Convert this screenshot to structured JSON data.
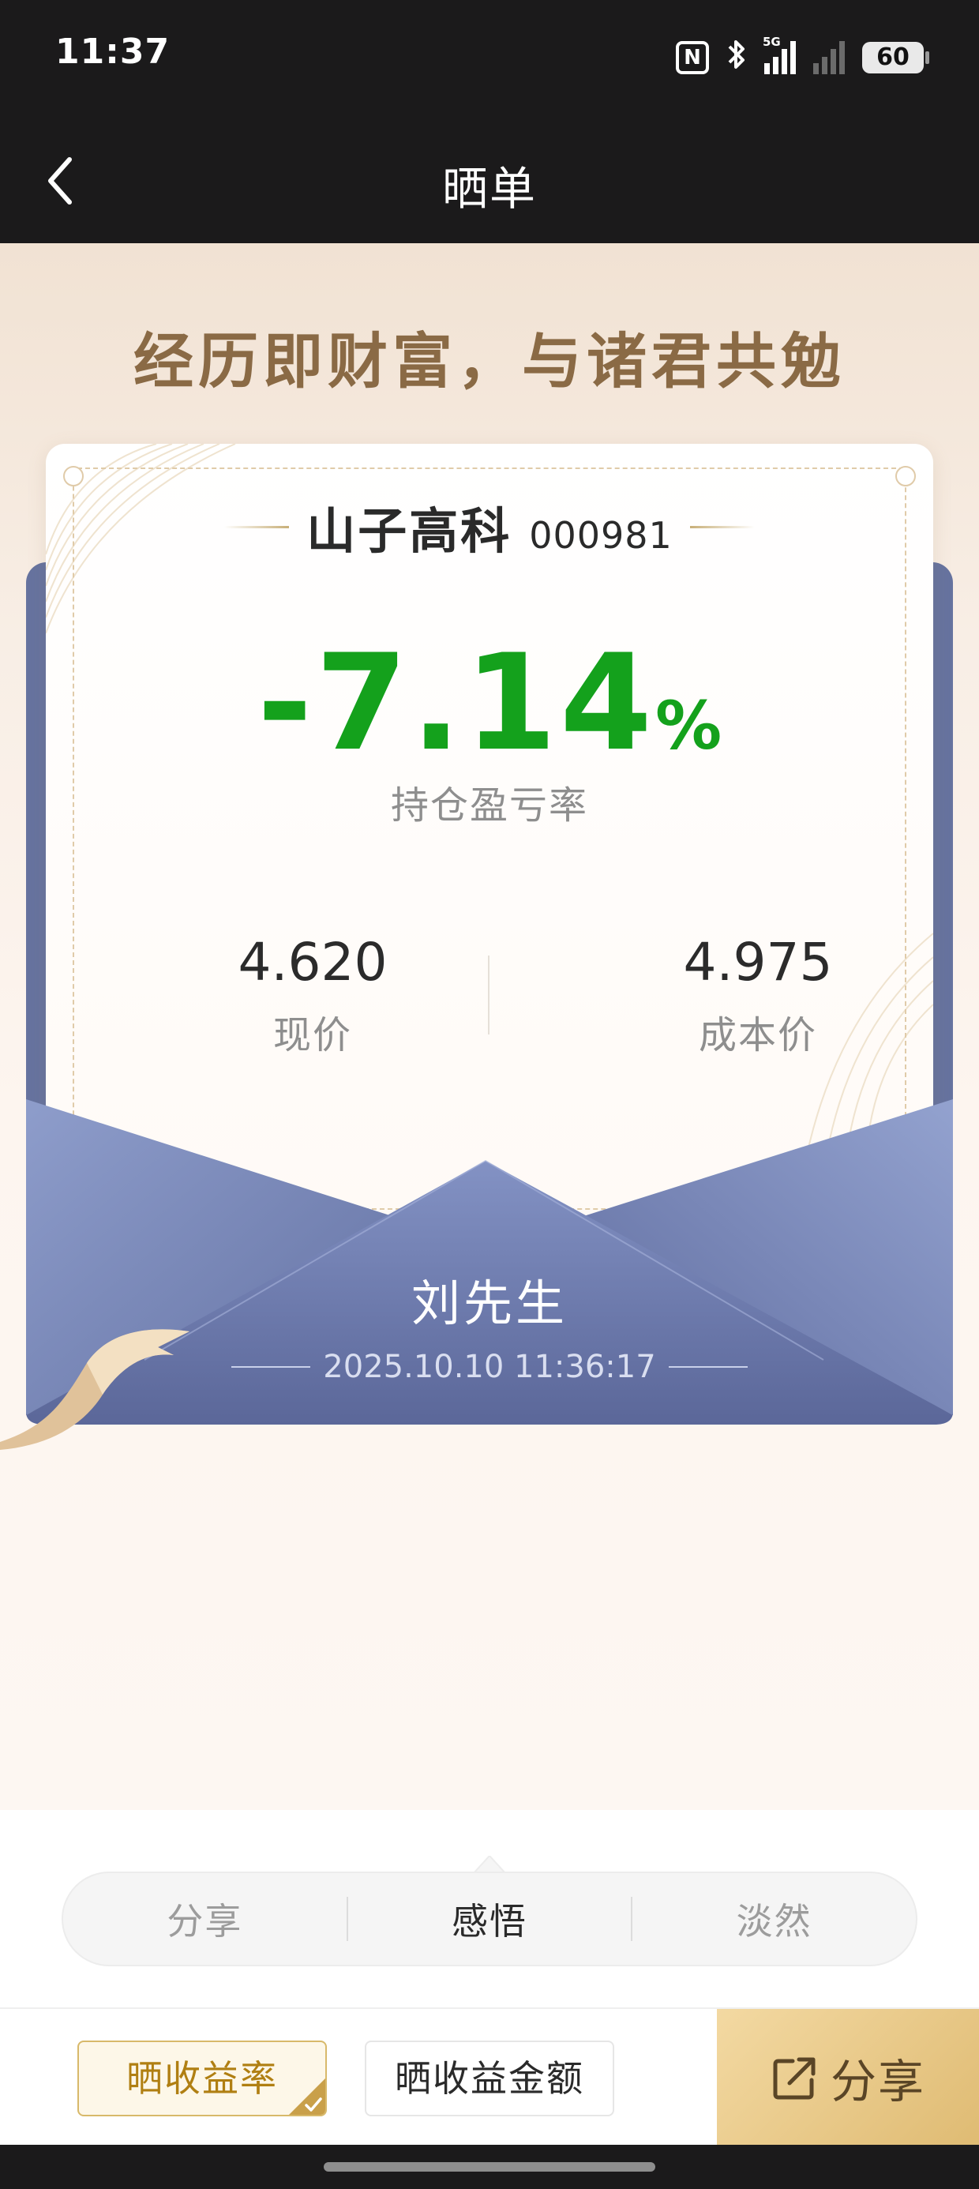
{
  "status_bar": {
    "time": "11:37",
    "nfc": "N",
    "signal_tag": "5G",
    "battery": "60"
  },
  "header": {
    "title": "晒单"
  },
  "slogan": "经历即财富，与诸君共勉",
  "stock": {
    "name": "山子高科",
    "code": "000981"
  },
  "holding": {
    "ratio_value": "-7.14",
    "ratio_unit": "%",
    "ratio_label": "持仓盈亏率",
    "current_price": "4.620",
    "current_price_label": "现价",
    "cost_price": "4.975",
    "cost_price_label": "成本价"
  },
  "envelope": {
    "name": "刘先生",
    "datetime": "2025.10.10 11:36:17"
  },
  "options": {
    "items": [
      "分享",
      "感悟",
      "淡然"
    ],
    "selected": "感悟"
  },
  "actions": {
    "rate_label": "晒收益率",
    "amount_label": "晒收益金额",
    "share_label": "分享",
    "rate_selected": true
  },
  "colors": {
    "loss_green": "#14a11c",
    "gold": "#b07f12",
    "envelope": "#66739f",
    "share_bg": "#e4c283"
  },
  "icons": [
    "back-icon",
    "nfc-icon",
    "bluetooth-icon",
    "signal-icon",
    "battery-icon",
    "share-icon",
    "check-icon"
  ]
}
